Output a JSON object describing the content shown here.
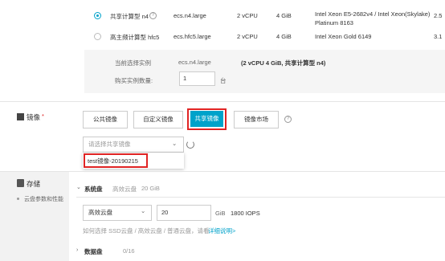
{
  "instance_rows": [
    {
      "name": "共享计算型 n4",
      "type": "ecs.n4.large",
      "vcpu": "2 vCPU",
      "mem": "4 GiB",
      "cpu_line1": "Intel Xeon E5-2682v4 / Intel Xeon(Skylake)",
      "cpu_line2": "Platinum 8163",
      "extra": "2.5",
      "selected": true
    },
    {
      "name": "高主频计算型 hfc5",
      "type": "ecs.hfc5.large",
      "vcpu": "2 vCPU",
      "mem": "4 GiB",
      "cpu_line1": "Intel Xeon Gold 6149",
      "cpu_line2": "",
      "extra": "3.1",
      "selected": false
    }
  ],
  "summary": {
    "current_label": "当前选择实例",
    "current_type": "ecs.n4.large",
    "current_desc": "(2 vCPU 4 GiB, 共享计算型 n4)",
    "qty_label": "购买实例数量:",
    "qty_value": "1",
    "qty_unit": "台"
  },
  "image": {
    "section_label": "镜像",
    "required_mark": "*",
    "tabs": [
      "公共镜像",
      "自定义镜像",
      "共享镜像",
      "镜像市场"
    ],
    "active_tab": "共享镜像",
    "select_placeholder": "请选择共享镜像",
    "dropdown_option": "test镜像-20190215",
    "accent": "#00a2ca",
    "highlight": "#e02424"
  },
  "storage": {
    "section_label": "存储",
    "sub_label": "云盘参数和性能",
    "system_disk_label": "系统盘",
    "system_disk_summary": "高效云盘",
    "system_disk_summary_size": "20 GiB",
    "disk_type": "高效云盘",
    "disk_size": "20",
    "disk_unit": "GiB",
    "iops": "1800 IOPS",
    "help_text": "如何选择 SSD云盘 / 高效云盘 / 普通云盘，请看",
    "help_link": "详细说明>",
    "data_disk_label": "数据盘",
    "data_disk_count": "0/16"
  }
}
